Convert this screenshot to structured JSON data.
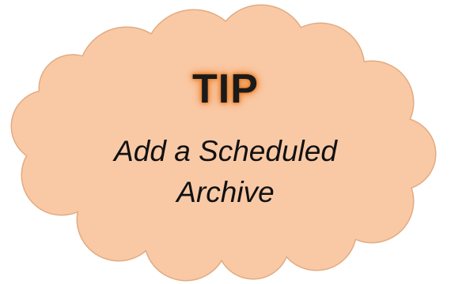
{
  "tip": {
    "heading": "TIP",
    "line1": "Add a Scheduled",
    "line2": "Archive"
  },
  "colors": {
    "cloud_fill": "#f9c9a6",
    "cloud_outline": "#e2ab80",
    "heading_glow": "#ef8a33",
    "text": "#111111"
  },
  "icons": {
    "shape": "cloud-shape"
  }
}
